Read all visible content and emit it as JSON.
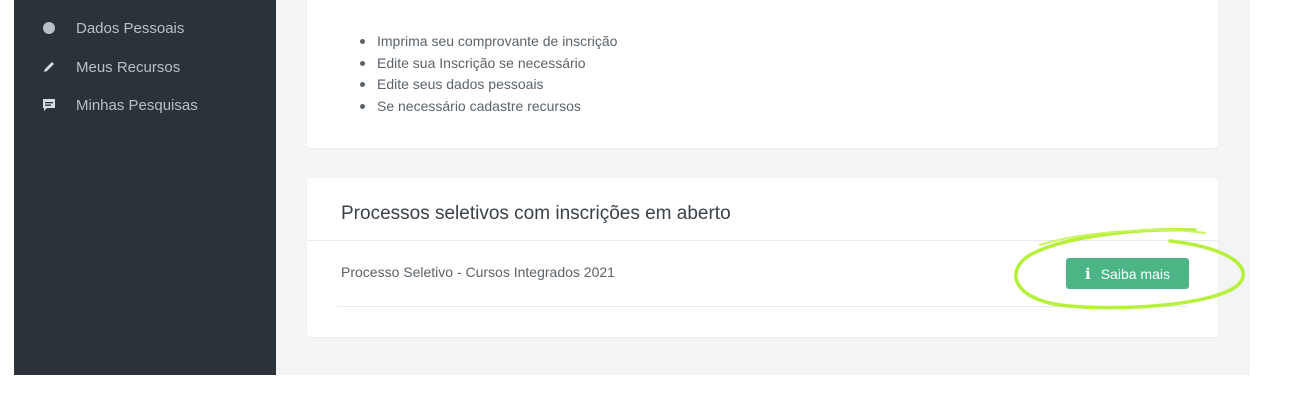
{
  "sidebar": {
    "items": [
      {
        "label": "Dados Pessoais",
        "icon": "person-icon"
      },
      {
        "label": "Meus Recursos",
        "icon": "pencil-icon"
      },
      {
        "label": "Minhas Pesquisas",
        "icon": "comment-icon"
      }
    ]
  },
  "instructions": {
    "items": [
      "Imprima seu comprovante de inscrição",
      "Edite sua Inscrição se necessário",
      "Edite seus dados pessoais",
      "Se necessário cadastre recursos"
    ]
  },
  "processes": {
    "title": "Processos seletivos com inscrições em aberto",
    "rows": [
      {
        "name": "Processo Seletivo - Cursos Integrados 2021",
        "button_label": "Saiba mais",
        "button_icon": "info-icon"
      }
    ]
  },
  "colors": {
    "sidebar_bg": "#2b3338",
    "main_bg": "#f2f4f6",
    "button_green": "#4cb585",
    "highlight": "#b6f03a"
  }
}
